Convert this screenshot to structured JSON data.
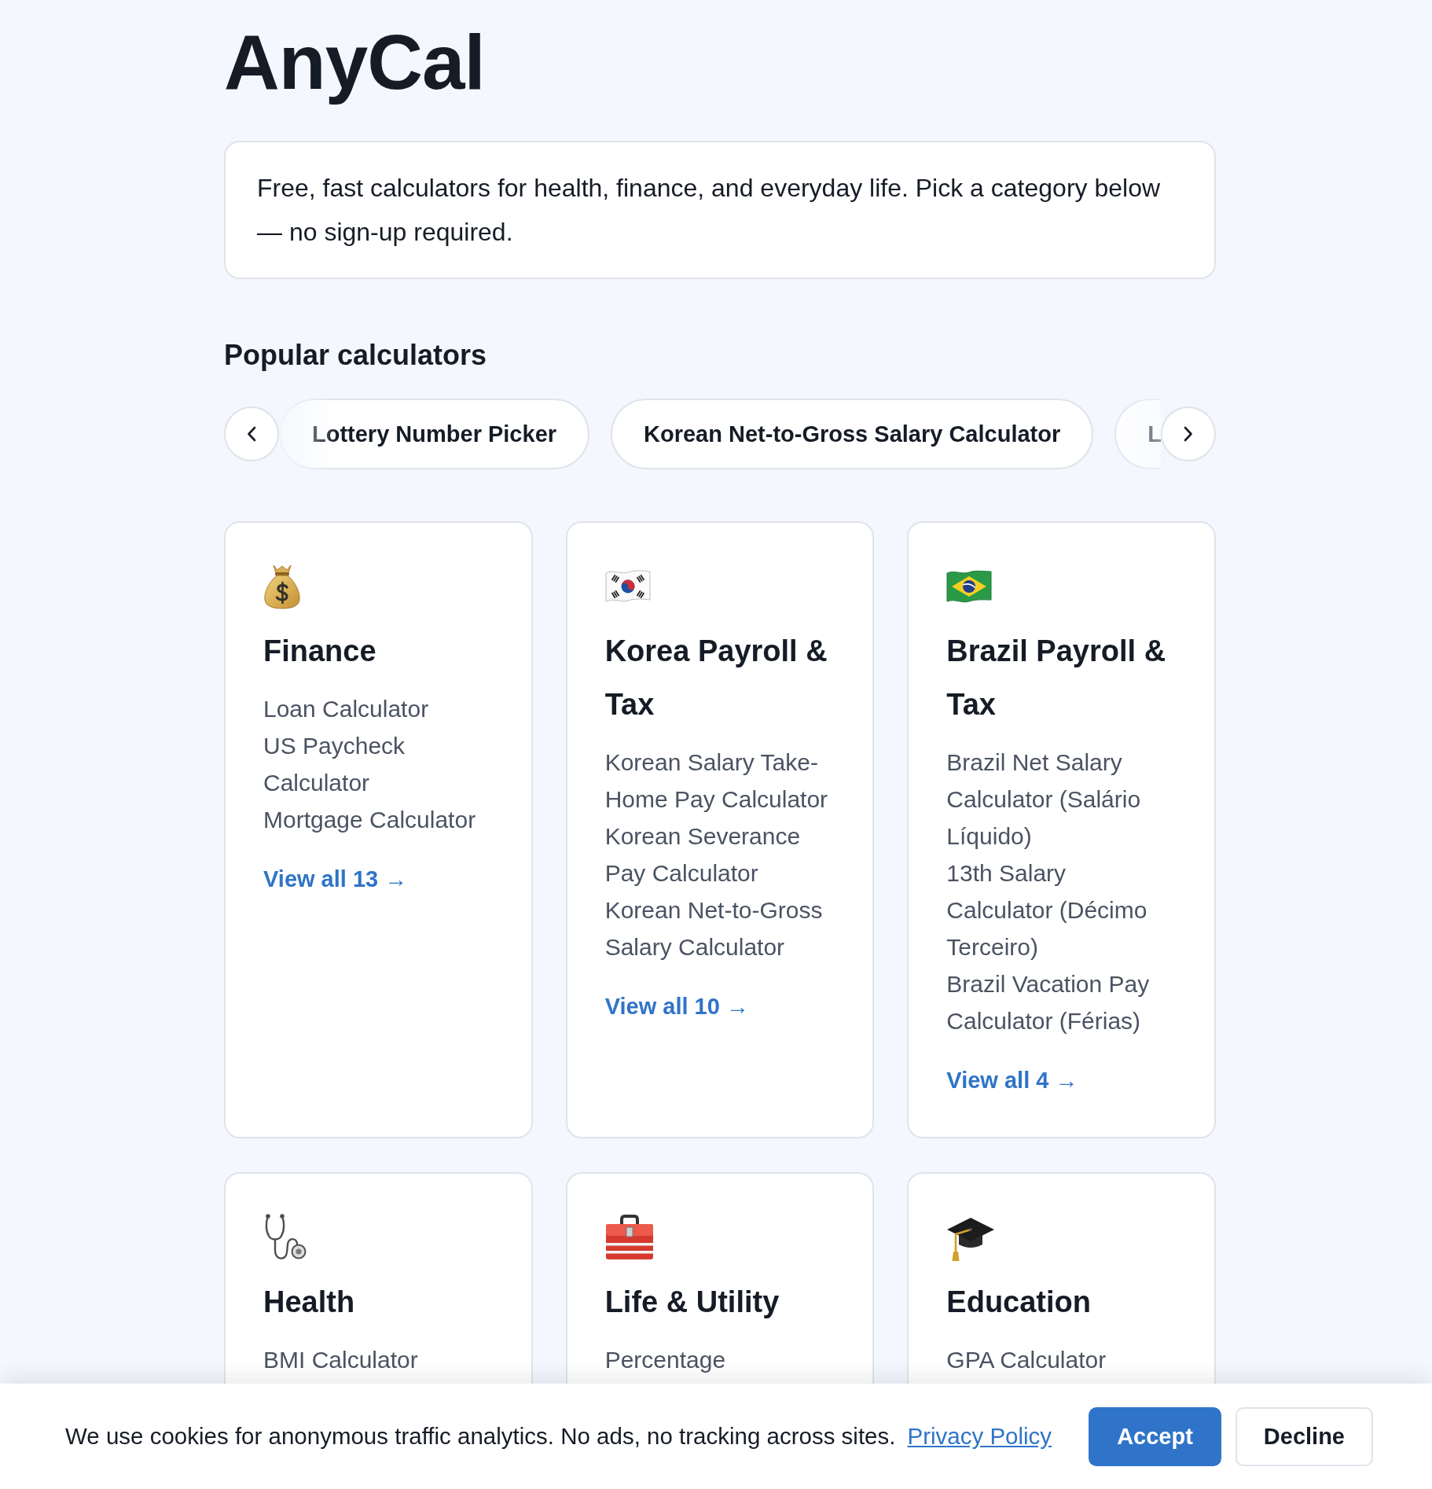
{
  "site_title": "AnyCal",
  "intro": "Free, fast calculators for health, finance, and everyday life. Pick a category below — no sign-up required.",
  "popular": {
    "heading": "Popular calculators",
    "items": [
      "Lottery Number Picker",
      "Korean Net-to-Gross Salary Calculator",
      "L"
    ]
  },
  "categories": [
    {
      "title": "Finance",
      "links": [
        "Loan Calculator",
        "US Paycheck Calculator",
        "Mortgage Calculator"
      ],
      "view_all": "View all 13 →"
    },
    {
      "title": "Korea Payroll & Tax",
      "links": [
        "Korean Salary Take-Home Pay Calculator",
        "Korean Severance Pay Calculator",
        "Korean Net-to-Gross Salary Calculator"
      ],
      "view_all": "View all 10 →"
    },
    {
      "title": "Brazil Payroll & Tax",
      "links": [
        "Brazil Net Salary Calculator (Salário Líquido)",
        "13th Salary Calculator (Décimo Terceiro)",
        "Brazil Vacation Pay Calculator (Férias)"
      ],
      "view_all": "View all 4 →"
    },
    {
      "title": "Health",
      "links": [
        "BMI Calculator"
      ]
    },
    {
      "title": "Life & Utility",
      "links": [
        "Percentage"
      ]
    },
    {
      "title": "Education",
      "links": [
        "GPA Calculator"
      ]
    }
  ],
  "cookie_banner": {
    "text": "We use cookies for anonymous traffic analytics. No ads, no tracking across sites.",
    "link": "Privacy Policy",
    "buttons": [
      {
        "label": "Accept",
        "kind": "primary"
      },
      {
        "label": "Decline",
        "kind": "secondary"
      }
    ]
  }
}
